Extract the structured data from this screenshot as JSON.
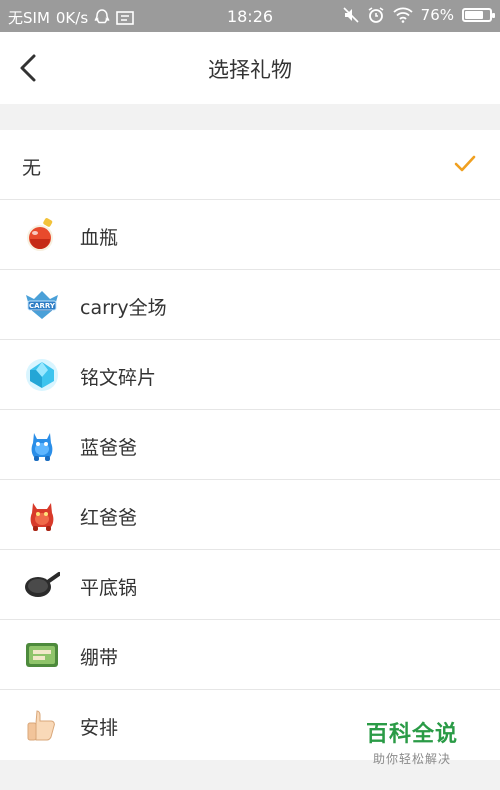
{
  "status_bar": {
    "carrier": "无SIM",
    "speed": "0K/s",
    "time": "18:26",
    "battery_text": "76%",
    "battery_level": 0.76
  },
  "nav": {
    "title": "选择礼物"
  },
  "gifts": [
    {
      "label": "无",
      "selected": true,
      "icon": "none"
    },
    {
      "label": "血瓶",
      "selected": false,
      "icon": "potion-icon"
    },
    {
      "label": "carry全场",
      "selected": false,
      "icon": "carry-badge-icon"
    },
    {
      "label": "铭文碎片",
      "selected": false,
      "icon": "gem-icon"
    },
    {
      "label": "蓝爸爸",
      "selected": false,
      "icon": "blue-buff-icon"
    },
    {
      "label": "红爸爸",
      "selected": false,
      "icon": "red-buff-icon"
    },
    {
      "label": "平底锅",
      "selected": false,
      "icon": "frying-pan-icon"
    },
    {
      "label": "绷带",
      "selected": false,
      "icon": "bandage-icon"
    },
    {
      "label": "安排",
      "selected": false,
      "icon": "thumbs-up-icon"
    }
  ],
  "watermark": {
    "title": "百科全说",
    "subtitle": "助你轻松解决"
  },
  "colors": {
    "accent": "#f0a020",
    "watermark_green": "#2a9b46"
  }
}
